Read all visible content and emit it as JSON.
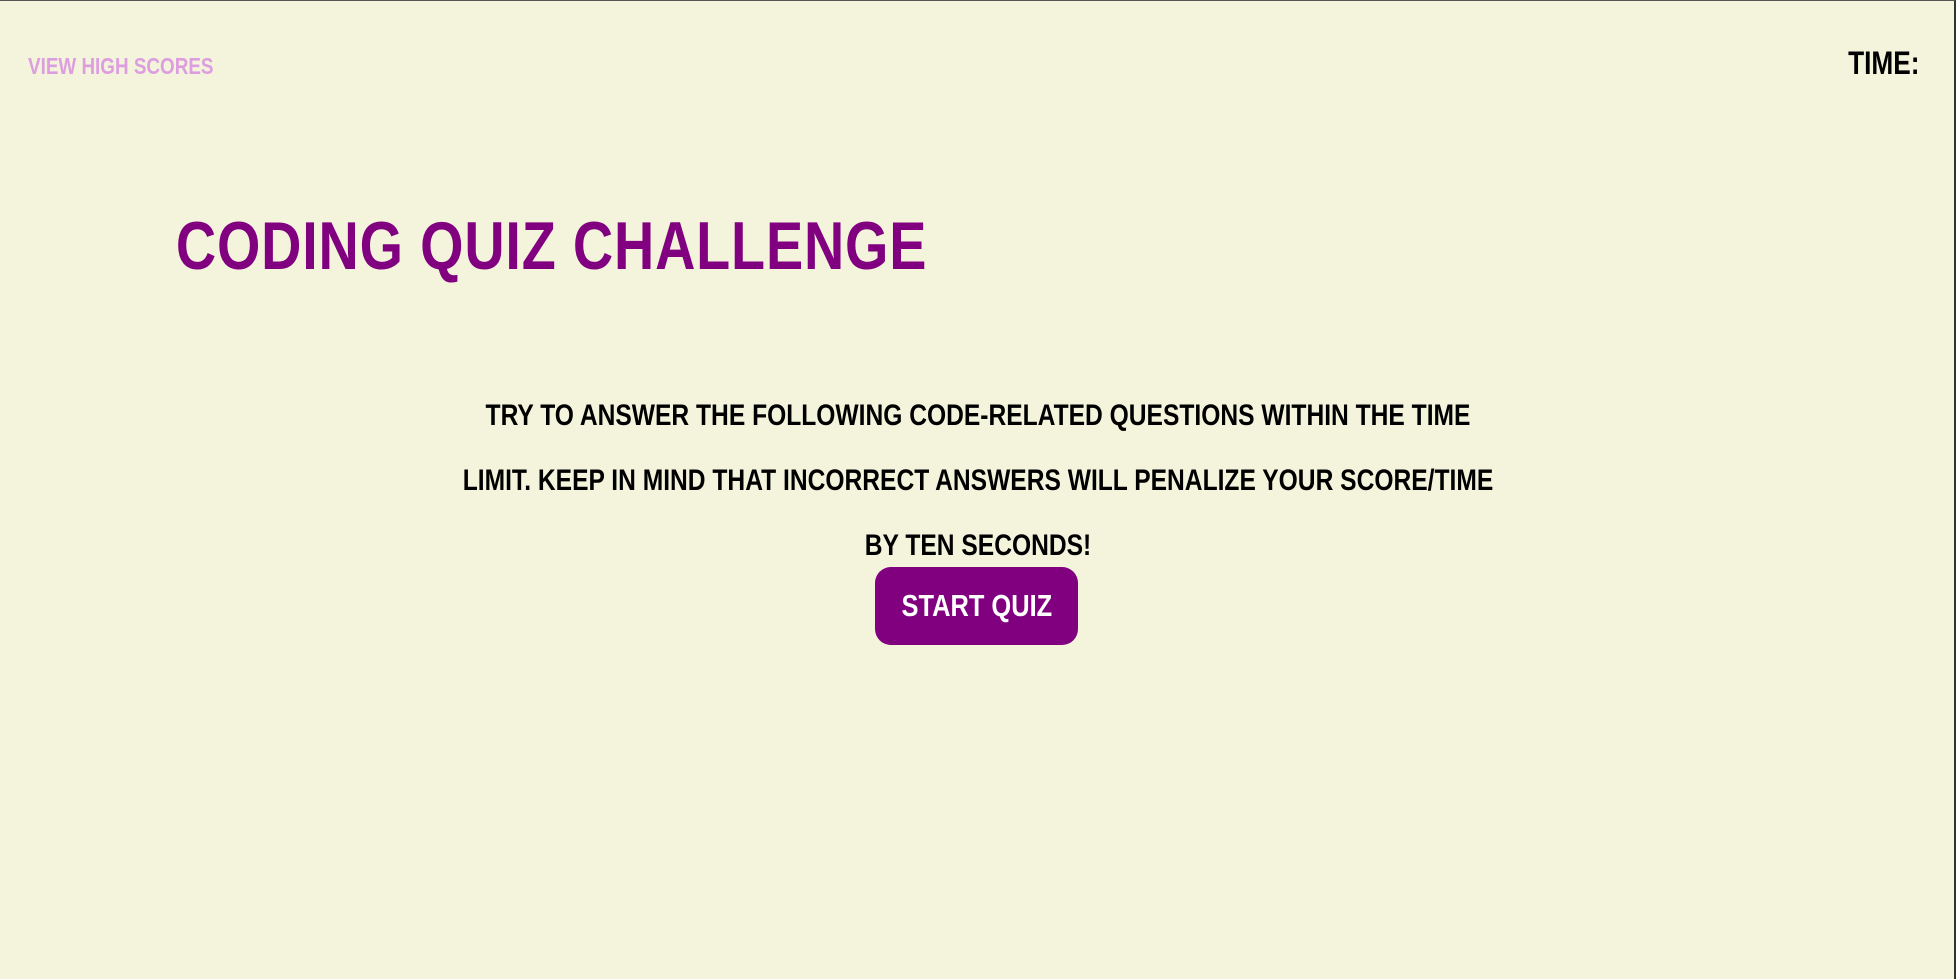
{
  "header": {
    "high_scores_label": "VIEW HIGH SCORES",
    "timer_label": "TIME:",
    "timer_value": ""
  },
  "main": {
    "title": "CODING QUIZ CHALLENGE",
    "intro_text": "TRY TO ANSWER THE FOLLOWING CODE-RELATED QUESTIONS WITHIN THE TIME LIMIT. KEEP IN MIND THAT INCORRECT ANSWERS WILL PENALIZE YOUR SCORE/TIME BY TEN SECONDS!",
    "start_button_label": "START QUIZ"
  },
  "colors": {
    "background": "#f4f4dc",
    "accent": "#800080",
    "link": "#dd9ee0",
    "text": "#000000"
  }
}
